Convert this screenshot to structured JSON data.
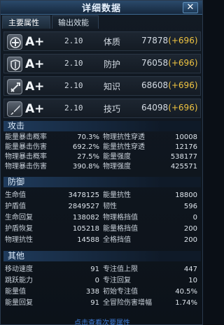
{
  "window": {
    "title": "详细数据",
    "close_label": "✕"
  },
  "tabs": [
    {
      "label": "主要属性",
      "active": true
    },
    {
      "label": "输出效能",
      "active": false
    }
  ],
  "attributes": [
    {
      "icon": "plus-shield-icon",
      "grade": "A+",
      "percent": "2.10",
      "name": "体质",
      "value": "77878",
      "bonus": "(+696)"
    },
    {
      "icon": "shield-icon",
      "grade": "A+",
      "percent": "2.10",
      "name": "防护",
      "value": "76058",
      "bonus": "(+696)"
    },
    {
      "icon": "crossed-swords-icon",
      "grade": "A+",
      "percent": "2.10",
      "name": "知识",
      "value": "68608",
      "bonus": "(+696)"
    },
    {
      "icon": "blade-icon",
      "grade": "A+",
      "percent": "2.10",
      "name": "技巧",
      "value": "64098",
      "bonus": "(+696)"
    }
  ],
  "sections": {
    "attack": {
      "title": "攻击",
      "stats": [
        [
          "能量暴击概率",
          "70.3%",
          "物理抗性穿透",
          "10008"
        ],
        [
          "能量暴击伤害",
          "692.2%",
          "能量抗性穿透",
          "12176"
        ],
        [
          "物理暴击概率",
          "27.5%",
          "能量强度",
          "538177"
        ],
        [
          "物理暴击伤害",
          "390.8%",
          "物理强度",
          "425571"
        ]
      ]
    },
    "defense": {
      "title": "防御",
      "stats": [
        [
          "生命值",
          "3478125",
          "能量抗性",
          "18800"
        ],
        [
          "护盾值",
          "2849527",
          "韧性",
          "596"
        ],
        [
          "生命回复",
          "138082",
          "物理格挡值",
          "0"
        ],
        [
          "护盾恢复",
          "105218",
          "能量格挡值",
          "200"
        ],
        [
          "物理抗性",
          "14588",
          "全格挡值",
          "200"
        ]
      ]
    },
    "other": {
      "title": "其他",
      "stats": [
        [
          "移动速度",
          "91",
          "专注值上限",
          "447"
        ],
        [
          "跳跃能力",
          "0",
          "专注回复",
          "10"
        ],
        [
          "能量值",
          "338",
          "初始专注值",
          "40.5%"
        ],
        [
          "能量回复",
          "91",
          "全冒险伤害增幅",
          "1.74%"
        ]
      ]
    }
  },
  "footer": {
    "link_text": "点击查看次要属性"
  }
}
